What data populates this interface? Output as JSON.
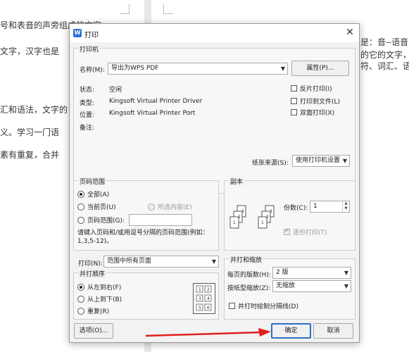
{
  "background": {
    "left_lines": [
      "号和表音的声旁组成的文字",
      "文字，汉字也是",
      "汇和语法，文字的",
      "义。学习一门语",
      "素有重复，合并"
    ],
    "right_lines": [
      "是：音--语音",
      "的它的文字，",
      "符、词汇、语"
    ]
  },
  "dialog": {
    "title": "打印",
    "logo_letter": "W",
    "close_glyph": "✕",
    "printer": {
      "group_label": "打印机",
      "name_label": "名称(M):",
      "name_value": "导出为WPS PDF",
      "properties_button": "属性(P)...",
      "status_label": "状态:",
      "status_value": "空闲",
      "type_label": "类型:",
      "type_value": "Kingsoft Virtual Printer Driver",
      "location_label": "位置:",
      "location_value": "Kingsoft Virtual Printer Port",
      "comment_label": "备注:",
      "reverse_print": "反片打印(I)",
      "print_to_file": "打印到文件(L)",
      "duplex": "双面打印(X)",
      "paper_source_label": "纸张来源(S):",
      "paper_source_value": "使用打印机设置"
    },
    "page_range": {
      "group_label": "页码范围",
      "all": "全部(A)",
      "current": "当前页(U)",
      "selection": "所选内容(E)",
      "pages": "页码范围(G):",
      "hint": "请键入页码和/或用逗号分隔的页码范围(例如：1,3,5-12)。"
    },
    "copies": {
      "group_label": "副本",
      "count_label": "份数(C):",
      "count_value": "1",
      "collate": "逐份打印(T)"
    },
    "print_what": {
      "label": "打印(N):",
      "value": "范围中所有页面"
    },
    "order": {
      "group_label": "并打顺序",
      "left_to_right": "从左到右(F)",
      "top_to_bottom": "从上到下(B)",
      "repeat": "重复(R)",
      "grid": [
        "1",
        "2",
        "3",
        "4",
        "5",
        "6"
      ]
    },
    "zoom": {
      "group_label": "并打和缩放",
      "pages_per_sheet_label": "每页的版数(H):",
      "pages_per_sheet_value": "2 版",
      "scale_label": "按纸型缩放(Z):",
      "scale_value": "无缩放",
      "draw_borders": "并打时绘制分隔线(D)"
    },
    "buttons": {
      "options": "选项(O)...",
      "ok": "确定",
      "cancel": "取消"
    }
  },
  "colors": {
    "accent": "#2a6fc9",
    "arrow": "#e02020",
    "logo": "#2f6fd8"
  }
}
